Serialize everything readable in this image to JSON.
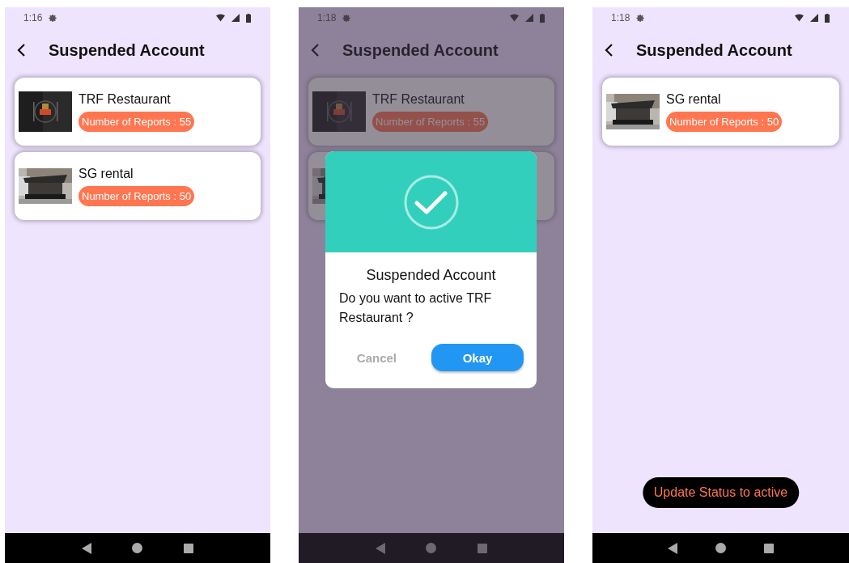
{
  "screens": [
    {
      "status_time": "1:16",
      "title": "Suspended Account",
      "dimmed": false,
      "cards": [
        {
          "name": "TRF Restaurant",
          "reports": "Number of Reports : 55"
        },
        {
          "name": "SG rental",
          "reports": "Number of Reports : 50"
        }
      ]
    },
    {
      "status_time": "1:18",
      "title": "Suspended Account",
      "dimmed": true,
      "cards": [
        {
          "name": "TRF Restaurant",
          "reports": "Number of Reports : 55"
        }
      ],
      "dialog": {
        "title": "Suspended Account",
        "message": "Do you want to active TRF Restaurant  ?",
        "buttons": [
          {
            "label": "Cancel",
            "kind": "text"
          },
          {
            "label": "Okay",
            "kind": "primary"
          }
        ]
      }
    },
    {
      "status_time": "1:18",
      "title": "Suspended Account",
      "dimmed": false,
      "cards": [
        {
          "name": "SG rental",
          "reports": "Number of Reports : 50"
        }
      ],
      "toast": "Update Status to active"
    }
  ]
}
